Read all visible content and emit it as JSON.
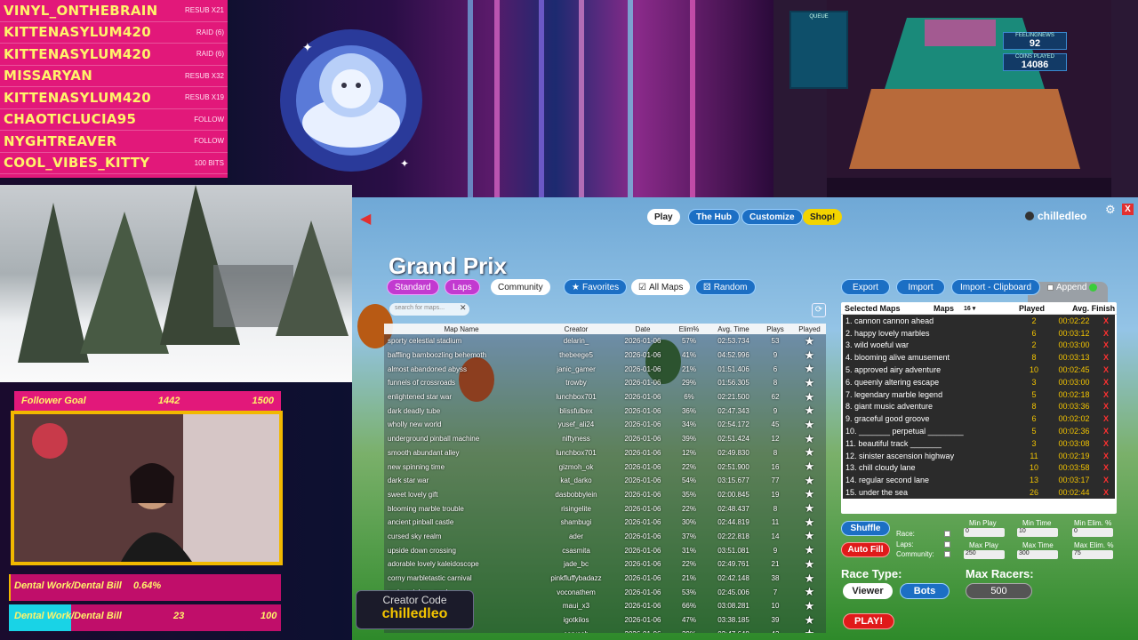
{
  "events": [
    {
      "name": "VINYL_ONTHEBRAIN",
      "type": "RESUB X21"
    },
    {
      "name": "KITTENASYLUM420",
      "type": "RAID (6)"
    },
    {
      "name": "KITTENASYLUM420",
      "type": "RAID (6)"
    },
    {
      "name": "MISSARYAN",
      "type": "RESUB X32"
    },
    {
      "name": "KITTENASYLUM420",
      "type": "RESUB X19"
    },
    {
      "name": "CHAOTICLUCIA95",
      "type": "FOLLOW"
    },
    {
      "name": "NYGHTREAVER",
      "type": "FOLLOW"
    },
    {
      "name": "COOL_VIBES_KITTY",
      "type": "100 BITS"
    }
  ],
  "pusher": {
    "queue": "QUEUE",
    "stat1_label": "FEELINGNEWS",
    "stat1_value": "92",
    "stat2_label": "COINS PLAYED",
    "stat2_value": "14086"
  },
  "follower_goal": {
    "label": "Follower Goal",
    "current": "1442",
    "target": "1500"
  },
  "dental1": {
    "label": "Dental Work/Dental Bill",
    "value": "0.64%",
    "fill": 0.0064
  },
  "dental2": {
    "label": "Dental Work/Dental Bill",
    "current": "23",
    "target": "100",
    "fill": 0.23
  },
  "creator": {
    "label": "Creator Code",
    "code": "chilledleo"
  },
  "nav": {
    "play": "Play",
    "hub": "The Hub",
    "customize": "Customize",
    "shop": "Shop!",
    "user": "chilledleo",
    "close": "X"
  },
  "page_title": "Grand Prix",
  "filters": {
    "standard": "Standard",
    "laps": "Laps",
    "community": "Community",
    "favorites": "Favorites",
    "all_maps": "All Maps",
    "random": "Random",
    "search_placeholder": "search for maps..."
  },
  "table": {
    "headers": {
      "name": "Map Name",
      "creator": "Creator",
      "date": "Date",
      "elim": "Elim%",
      "avg": "Avg. Time",
      "plays": "Plays",
      "played": "Played"
    },
    "rows": [
      {
        "name": "sporty celestial stadium",
        "creator": "delarin_",
        "date": "2026-01-06",
        "elim": "57%",
        "avg": "02:53.734",
        "plays": "53"
      },
      {
        "name": "baffling bamboozling behemoth",
        "creator": "thebeege5",
        "date": "2026-01-06",
        "elim": "41%",
        "avg": "04:52.996",
        "plays": "9"
      },
      {
        "name": "almost abandoned abyss",
        "creator": "janic_gamer",
        "date": "2026-01-06",
        "elim": "21%",
        "avg": "01:51.406",
        "plays": "6"
      },
      {
        "name": "funnels of crossroads",
        "creator": "trowby",
        "date": "2026-01-06",
        "elim": "29%",
        "avg": "01:56.305",
        "plays": "8"
      },
      {
        "name": "enlightened star war",
        "creator": "lunchbox701",
        "date": "2026-01-06",
        "elim": "6%",
        "avg": "02:21.500",
        "plays": "62"
      },
      {
        "name": "dark deadly tube",
        "creator": "blissfulbex",
        "date": "2026-01-06",
        "elim": "36%",
        "avg": "02:47.343",
        "plays": "9"
      },
      {
        "name": "wholly new world",
        "creator": "yusef_ali24",
        "date": "2026-01-06",
        "elim": "34%",
        "avg": "02:54.172",
        "plays": "45"
      },
      {
        "name": "underground pinball machine",
        "creator": "niftyness",
        "date": "2026-01-06",
        "elim": "39%",
        "avg": "02:51.424",
        "plays": "12"
      },
      {
        "name": "smooth abundant alley",
        "creator": "lunchbox701",
        "date": "2026-01-06",
        "elim": "12%",
        "avg": "02:49.830",
        "plays": "8"
      },
      {
        "name": "new spinning time",
        "creator": "gizmoh_ok",
        "date": "2026-01-06",
        "elim": "22%",
        "avg": "02:51.900",
        "plays": "16"
      },
      {
        "name": "dark star war",
        "creator": "kat_darko",
        "date": "2026-01-06",
        "elim": "54%",
        "avg": "03:15.677",
        "plays": "77"
      },
      {
        "name": "sweet lovely gift",
        "creator": "dasbobbylein",
        "date": "2026-01-06",
        "elim": "35%",
        "avg": "02:00.845",
        "plays": "19"
      },
      {
        "name": "blooming marble trouble",
        "creator": "risingelite",
        "date": "2026-01-06",
        "elim": "22%",
        "avg": "02:48.437",
        "plays": "8"
      },
      {
        "name": "ancient pinball castle",
        "creator": "shambugi",
        "date": "2026-01-06",
        "elim": "30%",
        "avg": "02:44.819",
        "plays": "11"
      },
      {
        "name": "cursed sky realm",
        "creator": "ader",
        "date": "2026-01-06",
        "elim": "37%",
        "avg": "02:22.818",
        "plays": "14"
      },
      {
        "name": "upside down crossing",
        "creator": "csasmita",
        "date": "2026-01-06",
        "elim": "31%",
        "avg": "03:51.081",
        "plays": "9"
      },
      {
        "name": "adorable lovely kaleidoscope",
        "creator": "jade_bc",
        "date": "2026-01-06",
        "elim": "22%",
        "avg": "02:49.761",
        "plays": "21"
      },
      {
        "name": "corny marbletastic carnival",
        "creator": "pinkfluffybadazz",
        "date": "2026-01-06",
        "elim": "21%",
        "avg": "02:42.148",
        "plays": "38"
      },
      {
        "name": "rocky rainbow mod",
        "creator": "voconathem",
        "date": "2026-01-06",
        "elim": "53%",
        "avg": "02:45.006",
        "plays": "7"
      },
      {
        "name": "",
        "creator": "maui_x3",
        "date": "2026-01-06",
        "elim": "66%",
        "avg": "03:08.281",
        "plays": "10"
      },
      {
        "name": "race",
        "creator": "igotkilos",
        "date": "2026-01-06",
        "elim": "47%",
        "avg": "03:38.185",
        "plays": "39"
      },
      {
        "name": "",
        "creator": "corvash",
        "date": "2026-01-06",
        "elim": "29%",
        "avg": "02:47.648",
        "plays": "43"
      }
    ]
  },
  "right": {
    "export": "Export",
    "import": "Import",
    "import_clip": "Import - Clipboard",
    "append": "Append",
    "headers": {
      "selected": "Selected Maps",
      "maps": "Maps",
      "maps_count": "16",
      "played": "Played",
      "avg_finish": "Avg. Finish"
    },
    "selected": [
      {
        "name": "1. cannon cannon ahead",
        "played": "2",
        "finish": "00:02:22"
      },
      {
        "name": "2. happy lovely marbles",
        "played": "6",
        "finish": "00:03:12"
      },
      {
        "name": "3. wild woeful war",
        "played": "2",
        "finish": "00:03:00"
      },
      {
        "name": "4. blooming alive amusement",
        "played": "8",
        "finish": "00:03:13"
      },
      {
        "name": "5. approved airy adventure",
        "played": "10",
        "finish": "00:02:45"
      },
      {
        "name": "6. queenly altering escape",
        "played": "3",
        "finish": "00:03:00"
      },
      {
        "name": "7. legendary marble legend",
        "played": "5",
        "finish": "00:02:18"
      },
      {
        "name": "8. giant music adventure",
        "played": "8",
        "finish": "00:03:36"
      },
      {
        "name": "9. graceful good groove",
        "played": "6",
        "finish": "00:02:02"
      },
      {
        "name": "10. _______ perpetual ________",
        "played": "5",
        "finish": "00:02:36"
      },
      {
        "name": "11. beautiful track _______",
        "played": "3",
        "finish": "00:03:08"
      },
      {
        "name": "12. sinister ascension highway",
        "played": "11",
        "finish": "00:02:19"
      },
      {
        "name": "13. chill cloudy lane",
        "played": "10",
        "finish": "00:03:58"
      },
      {
        "name": "14. regular second lane",
        "played": "13",
        "finish": "00:03:17"
      },
      {
        "name": "15. under the sea",
        "played": "26",
        "finish": "00:02:44"
      }
    ],
    "shuffle": "Shuffle",
    "autofill": "Auto Fill",
    "race_lbl": "Race:",
    "laps_lbl": "Laps:",
    "community_lbl": "Community:",
    "min_play": "Min Play",
    "min_time": "Min Time",
    "min_elim": "Min Elim. %",
    "max_play": "Max Play",
    "max_time": "Max Time",
    "max_elim": "Max Elim. %",
    "min_play_v": "0",
    "min_time_v": "10",
    "min_elim_v": "0",
    "max_play_v": "250",
    "max_time_v": "300",
    "max_elim_v": "75",
    "race_type": "Race Type:",
    "viewer": "Viewer",
    "bots": "Bots",
    "max_racers": "Max Racers:",
    "max_racers_v": "500",
    "play": "PLAY!"
  }
}
